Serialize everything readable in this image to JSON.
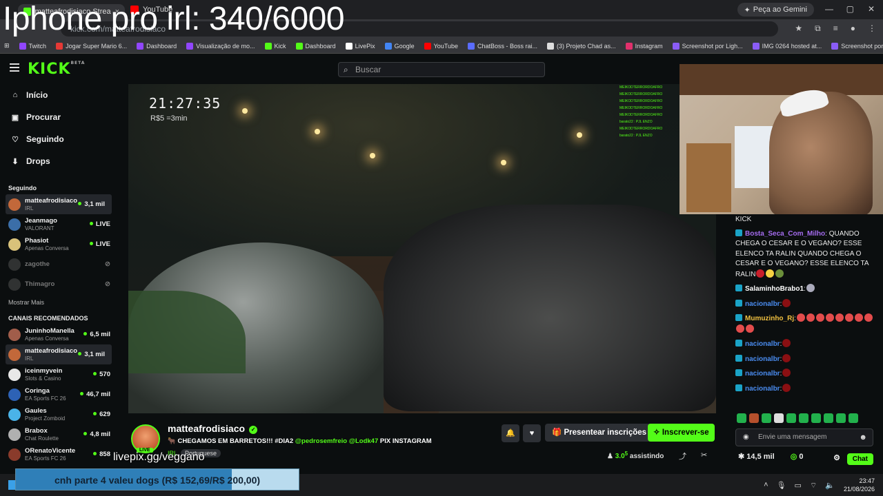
{
  "overlay": {
    "title": "Iphone pro irl: 340/6000",
    "livepix_url": "livepix.gg/veggano",
    "goal_text": "cnh parte 4 valeu dogs (R$ 152,69/R$ 200,00)",
    "goal_progress": 0.7635
  },
  "browser": {
    "tabs": [
      {
        "label": "matteafrodisiaco Stream - Watc",
        "close": "×"
      },
      {
        "label": "YouTube"
      }
    ],
    "gemini_label": "Peça ao Gemini",
    "url": "kick.com/matteafrodisiaco",
    "bookmarks": [
      {
        "label": "Twitch",
        "color": "#9146ff"
      },
      {
        "label": "Jogar Super Mario 6...",
        "color": "#e53935"
      },
      {
        "label": "Dashboard",
        "color": "#9146ff"
      },
      {
        "label": "Visualização de mo...",
        "color": "#9146ff"
      },
      {
        "label": "Kick",
        "color": "#53fc18"
      },
      {
        "label": "Dashboard",
        "color": "#53fc18"
      },
      {
        "label": "LivePix",
        "color": "#ffffff"
      },
      {
        "label": "Google",
        "color": "#4285f4"
      },
      {
        "label": "YouTube",
        "color": "#ff0000"
      },
      {
        "label": "ChatBoss - Boss rai...",
        "color": "#5a6cff"
      },
      {
        "label": "(3) Projeto Chad as...",
        "color": "#dddddd"
      },
      {
        "label": "Instagram",
        "color": "#e1306c"
      },
      {
        "label": "Screenshot por Ligh...",
        "color": "#8a5cf6"
      },
      {
        "label": "IMG 0264 hosted at...",
        "color": "#8a5cf6"
      },
      {
        "label": "Screenshot por Ligh...",
        "color": "#8a5cf6"
      }
    ]
  },
  "kick": {
    "logo": "KICK",
    "logo_sup": "BETA",
    "search_placeholder": "Buscar",
    "nav": [
      {
        "label": "Início",
        "icon": "home-icon",
        "glyph": "⌂"
      },
      {
        "label": "Procurar",
        "icon": "browse-icon",
        "glyph": "▣"
      },
      {
        "label": "Seguindo",
        "icon": "heart-icon",
        "glyph": "♡"
      },
      {
        "label": "Drops",
        "icon": "drops-icon",
        "glyph": "⬇"
      }
    ],
    "following_title": "Seguindo",
    "following": [
      {
        "name": "matteafrodisiaco",
        "sub": "IRL",
        "viewers": "3,1 mil",
        "live": true,
        "color": "#c2683a"
      },
      {
        "name": "Jeanmago",
        "sub": "VALORANT",
        "viewers": "LIVE",
        "live": true,
        "color": "#3b6ea8"
      },
      {
        "name": "Phasiot",
        "sub": "Apenas Conversa",
        "viewers": "LIVE",
        "live": true,
        "color": "#d9c27a"
      },
      {
        "name": "zagothe",
        "sub": "",
        "viewers": "",
        "live": false,
        "color": "#555555"
      },
      {
        "name": "Thimagro",
        "sub": "",
        "viewers": "",
        "live": false,
        "color": "#555555"
      }
    ],
    "show_more": "Mostrar Mais",
    "recommended_title": "CANAIS RECOMENDADOS",
    "recommended": [
      {
        "name": "JuninhoManella",
        "sub": "Apenas Conversa",
        "viewers": "6,5 mil",
        "color": "#a15d4a"
      },
      {
        "name": "matteafrodisiaco",
        "sub": "IRL",
        "viewers": "3,1 mil",
        "color": "#c2683a"
      },
      {
        "name": "iceinmyvein",
        "sub": "Slots & Casino",
        "viewers": "570",
        "color": "#e8e8e8"
      },
      {
        "name": "Coringa",
        "sub": "EA Sports FC 26",
        "viewers": "46,7 mil",
        "color": "#2d62b5"
      },
      {
        "name": "Gaules",
        "sub": "Project Zomboid",
        "viewers": "629",
        "color": "#4ab3e8"
      },
      {
        "name": "Brabox",
        "sub": "Chat Roulette",
        "viewers": "4,8 mil",
        "color": "#b0b0b0"
      },
      {
        "name": "ORenatoVicente",
        "sub": "EA Sports FC 26",
        "viewers": "858",
        "color": "#8a3b2b"
      }
    ]
  },
  "video": {
    "clock": "21:27:35",
    "clock_sub": "R$5 =3min",
    "mini_chat": [
      "MEIKODTERRORDOAFRO",
      "MEIKODTERRORDOAFRO",
      "MEIKODTERRORDOAFRO",
      "MEIKODTERRORDOAFRO",
      "MEIKODTERRORDOAFRO",
      "barato22 : PJL ENZO",
      "MEIKODTERRORDOAFRO",
      "barato22 : PJL ENZO"
    ]
  },
  "chat": {
    "messages": [
      {
        "user": "",
        "text": "KICK",
        "color": "#ffffff"
      },
      {
        "user": "Bosta_Seca_Com_Milho",
        "text": ": QUANDO CHEGA O CESAR E O VEGANO? ESSE ELENCO TA RALIN QUANDO CHEGA O CESAR E O VEGANO? ESSE ELENCO TA RALIN",
        "color": "#a56cf0"
      },
      {
        "user": "SalaminhoBrabo1",
        "text": ":",
        "color": "#ffffff"
      },
      {
        "user": "nacionalbr",
        "text": ":",
        "color": "#4a8cf0"
      },
      {
        "user": "Mumuzinho_Rj",
        "text": ":",
        "color": "#f0c040"
      },
      {
        "user": "nacionalbr",
        "text": ":",
        "color": "#4a8cf0"
      },
      {
        "user": "nacionalbr",
        "text": ":",
        "color": "#4a8cf0"
      },
      {
        "user": "nacionalbr",
        "text": ":",
        "color": "#4a8cf0"
      },
      {
        "user": "nacionalbr",
        "text": ":",
        "color": "#4a8cf0"
      }
    ],
    "input_placeholder": "Envie uma mensagem",
    "points": "14,5 mil",
    "kicks": "0",
    "chat_button": "Chat"
  },
  "stream": {
    "name": "matteafrodisiaco",
    "live_label": "LIVE",
    "title_pre": "CHEGAMOS EM BARRETOS!!! ",
    "title_tag": "#DIA2",
    "title_m1": "@pedrosemfreio",
    "title_m2": "@Lodk47",
    "title_post": "PIX INSTAGRAM",
    "category": "IRL",
    "language": "Portuguese",
    "gift_label": "Presentear inscrições",
    "sub_label": "Inscrever-se",
    "viewers": "3.0",
    "viewers_suffix": "5",
    "watching_label": "assistindo"
  },
  "taskbar": {
    "time": "23:47",
    "date": "21/08/2026"
  }
}
